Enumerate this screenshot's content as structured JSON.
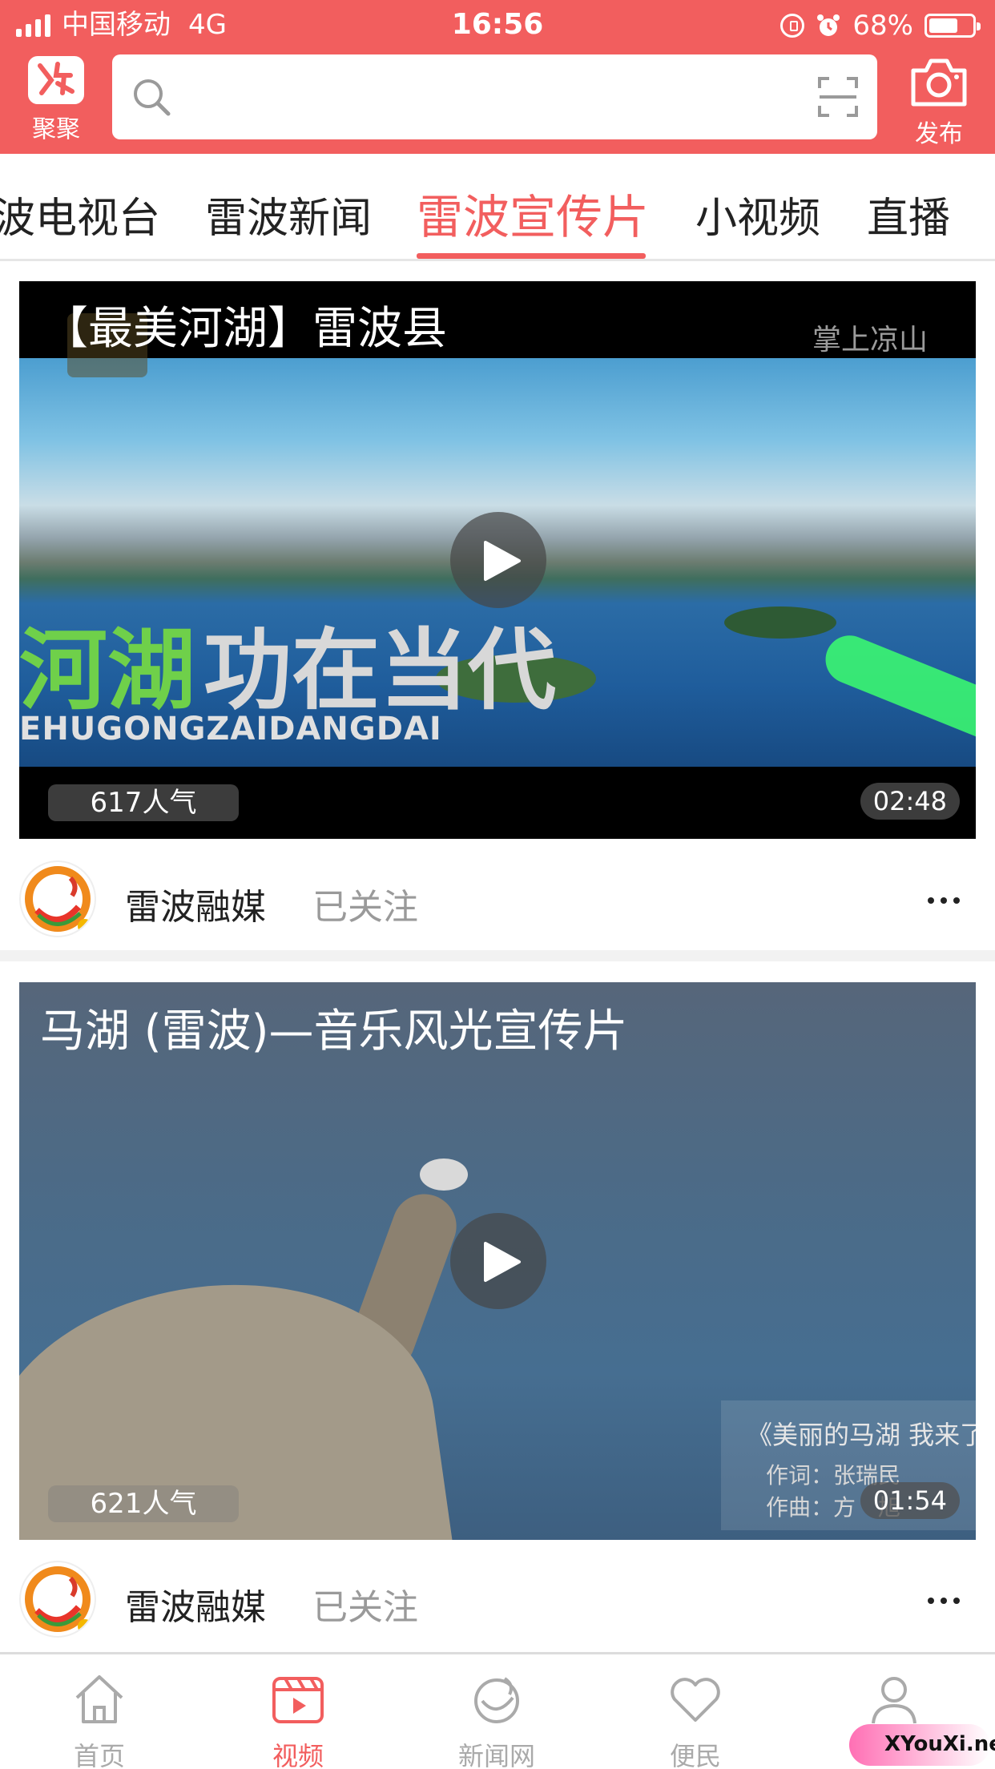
{
  "status_bar": {
    "carrier": "中国移动",
    "network": "4G",
    "time": "16:56",
    "battery": "68%",
    "battery_level": 0.68
  },
  "header": {
    "logo_label": "聚聚",
    "search_placeholder": "",
    "publish_label": "发布"
  },
  "tabs": [
    {
      "label": "波电视台",
      "active": false
    },
    {
      "label": "雷波新闻",
      "active": false
    },
    {
      "label": "雷波宣传片",
      "active": true
    },
    {
      "label": "小视频",
      "active": false
    },
    {
      "label": "直播",
      "active": false
    }
  ],
  "videos": [
    {
      "title": "【最美河湖】雷波县",
      "views": "617人气",
      "duration": "02:48",
      "overlay_big_left": "河湖",
      "overlay_big_right": "功在当代",
      "overlay_sub": "EHUGONGZAIDANGDAI",
      "watermark": "掌上凉山",
      "author": "雷波融媒",
      "follow_status": "已关注"
    },
    {
      "title": "马湖 (雷波)—音乐风光宣传片",
      "views": "621人气",
      "duration": "01:54",
      "lyric_title": "《美丽的马湖 我来了",
      "lyric_line1": "作词：张瑞民",
      "lyric_line2": "作曲：方　旭",
      "author": "雷波融媒",
      "follow_status": "已关注"
    }
  ],
  "bottom_nav": [
    {
      "label": "首页",
      "icon": "home-icon",
      "active": false
    },
    {
      "label": "视频",
      "icon": "video-icon",
      "active": true
    },
    {
      "label": "新闻网",
      "icon": "news-icon",
      "active": false
    },
    {
      "label": "便民",
      "icon": "heart-icon",
      "active": false
    },
    {
      "label": "",
      "icon": "profile-icon",
      "active": false
    }
  ],
  "corner_badge": "XYouXi.net",
  "colors": {
    "brand": "#f25e5e",
    "inactive": "#aaaaaa"
  }
}
